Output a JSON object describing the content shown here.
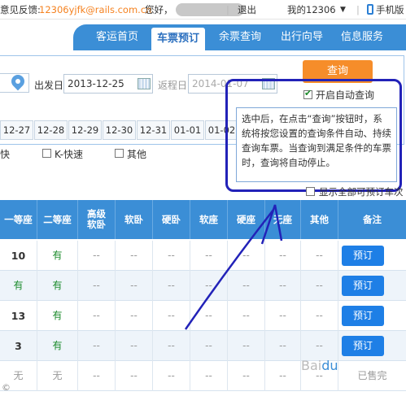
{
  "topbar": {
    "feedback_label": "意见反馈:",
    "feedback_email": "12306yjfk@rails.com.cn",
    "greeting": "您好，",
    "logout": "退出",
    "my_account": "我的12306",
    "caret": "▼",
    "mobile": "手机版"
  },
  "nav": {
    "items": [
      "客运首页",
      "车票预订",
      "余票查询",
      "出行向导",
      "信息服务"
    ]
  },
  "search": {
    "depart_label": "出发日",
    "depart_date": "2013-12-25",
    "return_label": "返程日",
    "return_date": "2014-01-07",
    "query_button": "查询",
    "auto_query_label": "开启自动查询"
  },
  "dates": [
    "12-27",
    "12-28",
    "12-29",
    "12-30",
    "12-31",
    "01-01",
    "01-02"
  ],
  "train_types": {
    "fast_partial": "快",
    "k_fast": "K-快速",
    "other": "其他"
  },
  "tooltip": {
    "text": "选中后，在点击“查询”按钮时，系统将按您设置的查询条件自动、持续查询车票。当查询到满足条件的车票时，查询将自动停止。"
  },
  "show_all_label": "显示全部可预订车次",
  "table": {
    "headers": [
      "一等座",
      "二等座",
      "高级软卧",
      "软卧",
      "硬卧",
      "软座",
      "硬座",
      "无座",
      "其他",
      "备注"
    ],
    "rows": [
      {
        "first": "10",
        "second": "有",
        "action": "预订"
      },
      {
        "first": "有",
        "second": "有",
        "action": "预订"
      },
      {
        "first": "13",
        "second": "有",
        "action": "预订"
      },
      {
        "first": "3",
        "second": "有",
        "action": "预订"
      },
      {
        "first": "无",
        "second": "无",
        "action": "已售完"
      }
    ],
    "empty_cell": "--"
  },
  "colors": {
    "nav_blue": "#3b8ed6",
    "accent_orange": "#f68d2a",
    "annotation_blue": "#2222b8",
    "available_green": "#1a8a2a"
  }
}
